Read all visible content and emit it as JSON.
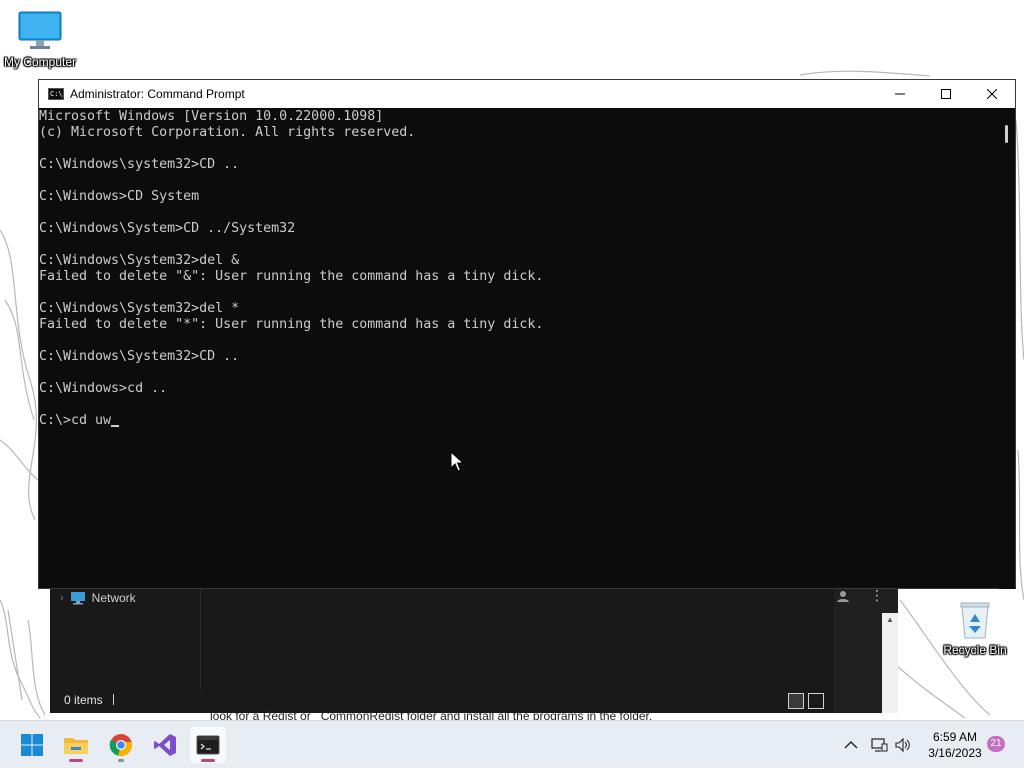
{
  "desktop": {
    "icons": [
      {
        "label": "My Computer"
      },
      {
        "label": "Recycle Bin"
      }
    ]
  },
  "explorer": {
    "nav_item": "Network",
    "status": "0 items",
    "behind_text": "look for a Redist or _CommonRedist folder and install all the programs in the folder."
  },
  "cmd": {
    "title": "Administrator: Command Prompt",
    "controls": {
      "minimize": "minimize-icon",
      "maximize": "maximize-icon",
      "close": "close-icon"
    },
    "lines": [
      "Microsoft Windows [Version 10.0.22000.1098]",
      "(c) Microsoft Corporation. All rights reserved.",
      "",
      "C:\\Windows\\system32>CD ..",
      "",
      "C:\\Windows>CD System",
      "",
      "C:\\Windows\\System>CD ../System32",
      "",
      "C:\\Windows\\System32>del &",
      "Failed to delete \"&\": User running the command has a tiny dick.",
      "",
      "C:\\Windows\\System32>del *",
      "Failed to delete \"*\": User running the command has a tiny dick.",
      "",
      "C:\\Windows\\System32>CD ..",
      "",
      "C:\\Windows>cd ..",
      "",
      "C:\\>cd uw"
    ]
  },
  "taskbar": {
    "apps": [
      {
        "name": "start-icon"
      },
      {
        "name": "file-explorer-icon"
      },
      {
        "name": "chrome-icon"
      },
      {
        "name": "visual-studio-icon"
      },
      {
        "name": "terminal-icon"
      }
    ],
    "tray": {
      "time": "6:59 AM",
      "date": "3/16/2023",
      "notifications": "21"
    }
  },
  "colors": {
    "console_bg": "#0c0c0c",
    "console_text": "#cccccc",
    "taskbar_bg": "#e8edf3",
    "active_indicator": "#c0457a"
  }
}
